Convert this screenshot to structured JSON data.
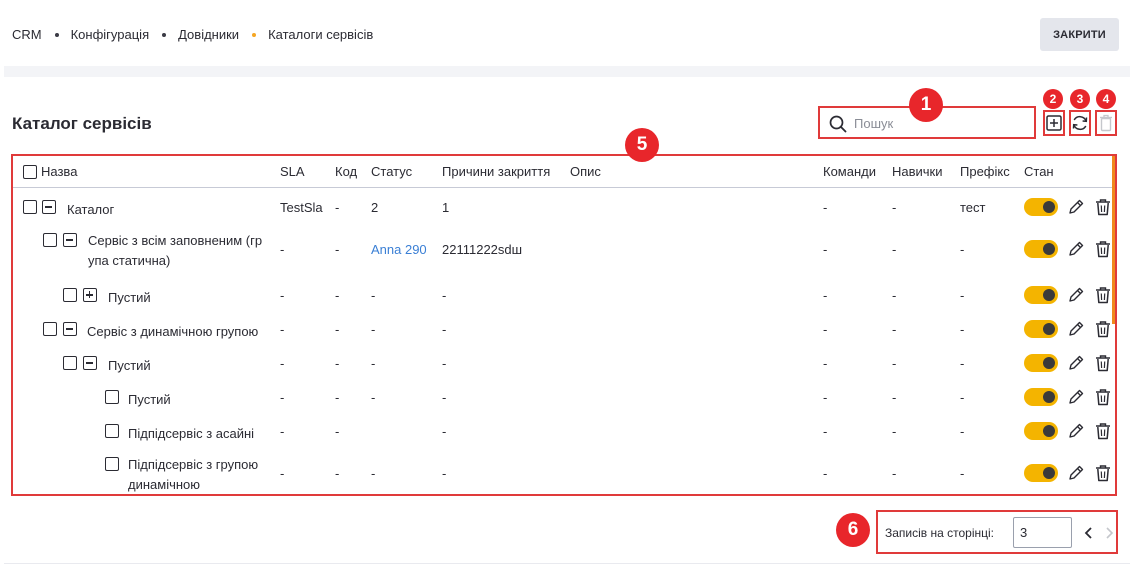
{
  "breadcrumb": [
    "CRM",
    "Конфігурація",
    "Довідники",
    "Каталоги сервісів"
  ],
  "header": {
    "close_label": "ЗАКРИТИ"
  },
  "page": {
    "title": "Каталог сервісів"
  },
  "search": {
    "placeholder": "Пошук",
    "value": ""
  },
  "callouts": [
    "1",
    "2",
    "3",
    "4",
    "5",
    "6"
  ],
  "table": {
    "columns": [
      "Назва",
      "SLA",
      "Код",
      "Статус",
      "Причини закриття",
      "Опис",
      "Команди",
      "Навички",
      "Префікс",
      "Стан"
    ],
    "rows": [
      {
        "name": "Каталог",
        "name2": "",
        "sla": "TestSla",
        "code": "-",
        "status": "2",
        "reasons": "1",
        "desc": "",
        "teams": "-",
        "skills": "-",
        "prefix": "тест"
      },
      {
        "name": "Сервіс з всім заповненим (гр",
        "name2": "упа статична)",
        "sla": "-",
        "code": "-",
        "status": "Anna 290",
        "reasons": "22111222sdш",
        "desc": "",
        "teams": "-",
        "skills": "-",
        "prefix": "-"
      },
      {
        "name": "Пустий",
        "name2": "",
        "sla": "-",
        "code": "-",
        "status": "-",
        "reasons": "-",
        "desc": "",
        "teams": "-",
        "skills": "-",
        "prefix": "-"
      },
      {
        "name": "Сервіс з динамічною групою",
        "name2": "",
        "sla": "-",
        "code": "-",
        "status": "-",
        "reasons": "-",
        "desc": "",
        "teams": "-",
        "skills": "-",
        "prefix": "-"
      },
      {
        "name": "Пустий",
        "name2": "",
        "sla": "-",
        "code": "-",
        "status": "-",
        "reasons": "-",
        "desc": "",
        "teams": "-",
        "skills": "-",
        "prefix": "-"
      },
      {
        "name": "Пустий",
        "name2": "",
        "sla": "-",
        "code": "-",
        "status": "-",
        "reasons": "-",
        "desc": "",
        "teams": "-",
        "skills": "-",
        "prefix": "-"
      },
      {
        "name": "Підпідсервіс з асайні",
        "name2": "",
        "sla": "-",
        "code": "-",
        "status": "",
        "reasons": "-",
        "desc": "",
        "teams": "-",
        "skills": "-",
        "prefix": "-"
      },
      {
        "name": "Підпідсервіс з групою",
        "name2": "динамічною",
        "sla": "-",
        "code": "-",
        "status": "-",
        "reasons": "-",
        "desc": "",
        "teams": "-",
        "skills": "-",
        "prefix": "-"
      }
    ]
  },
  "pagination": {
    "label": "Записів на сторінці:",
    "value": "3"
  },
  "colors": {
    "accent": "#f4b400",
    "callout": "#e8262b",
    "link": "#3a7fd5",
    "highlight": "#e03a3a"
  }
}
